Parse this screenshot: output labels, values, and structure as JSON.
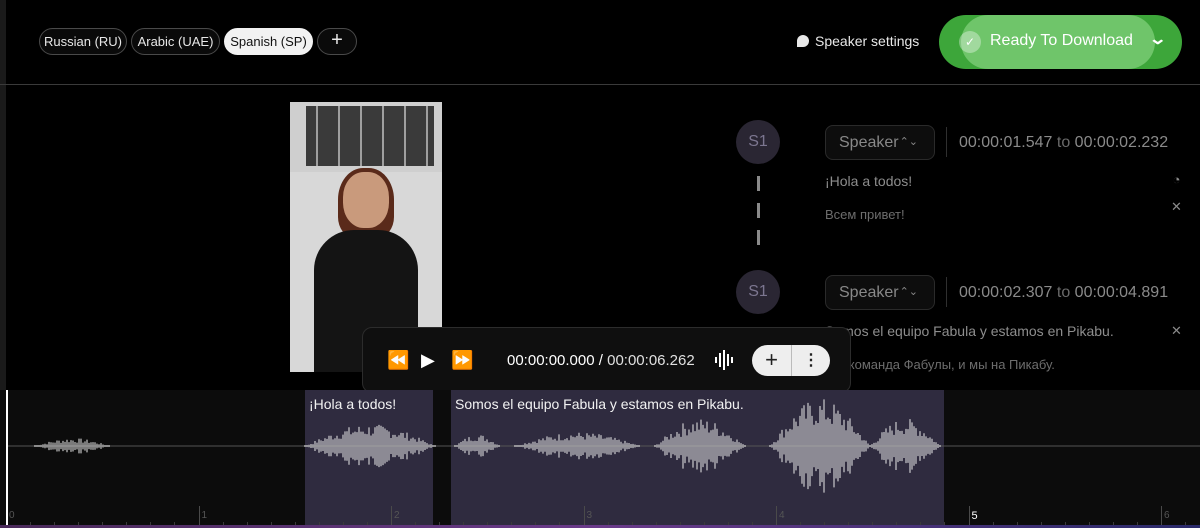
{
  "languages": {
    "tabs": [
      "Russian (RU)",
      "Arabic (UAE)",
      "Spanish (SP)"
    ],
    "active": "Spanish (SP)",
    "add_label": "+"
  },
  "header": {
    "speaker_settings": "Speaker settings",
    "download_label": "Ready To Download",
    "download_check": "✓",
    "download_chevron": "⌄"
  },
  "segments": [
    {
      "marker": "S1",
      "speaker": "Speaker",
      "start": "00:00:01.547",
      "to": "to",
      "end": "00:00:02.232",
      "text": "¡Hola a todos!",
      "translation": "Всем привет!"
    },
    {
      "marker": "S1",
      "speaker": "Speaker",
      "start": "00:00:02.307",
      "to": "to",
      "end": "00:00:04.891",
      "text": "Somos el equipo Fabula y estamos en Pikabu.",
      "translation": "Мы команда Фабулы, и мы на Пикабу."
    }
  ],
  "player": {
    "current": "00:00:00.000",
    "separator": "/",
    "duration": "00:00:06.262",
    "rewind": "⏪",
    "play": "▶",
    "forward": "⏩",
    "add": "+",
    "more": "⋮"
  },
  "timeline": {
    "regions": [
      {
        "label": "¡Hola a todos!"
      },
      {
        "label": "Somos el equipo Fabula y estamos en Pikabu."
      }
    ],
    "ruler": [
      "0",
      "1",
      "2",
      "3",
      "4",
      "5",
      "6"
    ],
    "highlighted_second": "5"
  },
  "colors": {
    "download_green": "#3da63a",
    "region": "#2f2b3f",
    "marker": "#2a2633"
  }
}
